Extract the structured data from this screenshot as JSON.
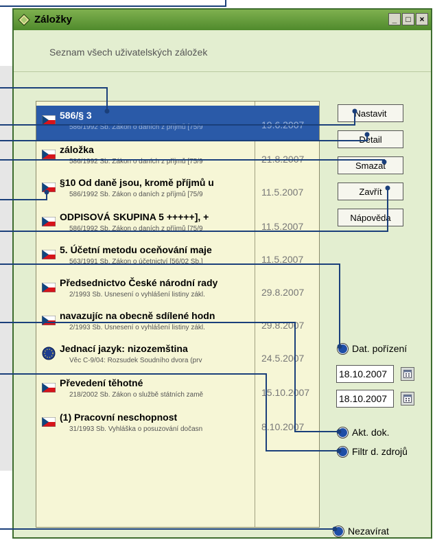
{
  "window": {
    "title": "Záložky",
    "subtitle": "Seznam všech uživatelských záložek",
    "controls": [
      "_",
      "□",
      "×"
    ],
    "accent_color": "#2a5aa8"
  },
  "bookmarks": [
    {
      "title": "586/§ 3",
      "subtitle": "586/1992 Sb. Zákon o daních z příjmů [75/9",
      "date": "19.6.2007",
      "icon": "czech-flag-icon",
      "selected": true
    },
    {
      "title": "záložka",
      "subtitle": "586/1992 Sb. Zákon o daních z příjmů [75/9",
      "date": "21.8.2007",
      "icon": "czech-flag-icon",
      "selected": false
    },
    {
      "title": "§10 Od daně jsou, kromě příjmů u",
      "subtitle": "586/1992 Sb. Zákon o daních z příjmů [75/9",
      "date": "11.5.2007",
      "icon": "czech-flag-icon",
      "selected": false
    },
    {
      "title": "ODPISOVÁ SKUPINA 5 +++++], +",
      "subtitle": "586/1992 Sb. Zákon o daních z příjmů [75/9",
      "date": "11.5.2007",
      "icon": "czech-flag-icon",
      "selected": false
    },
    {
      "title": "5. Účetní metodu oceňování maje",
      "subtitle": "563/1991 Sb. Zákon o účetnictví [56/02 Sb.]",
      "date": "11.5.2007",
      "icon": "czech-flag-icon",
      "selected": false
    },
    {
      "title": "Předsednictvo České národní rady",
      "subtitle": "2/1993 Sb. Usnesení o vyhlášení listiny zákl.",
      "date": "29.8.2007",
      "icon": "czech-flag-icon",
      "selected": false
    },
    {
      "title": "navazujíc na obecně sdílené hodn",
      "subtitle": "2/1993 Sb. Usnesení o vyhlášení listiny zákl.",
      "date": "29.8.2007",
      "icon": "czech-flag-icon",
      "selected": false
    },
    {
      "title": "Jednací jazyk: nizozemština",
      "subtitle": "Věc C-9/04: Rozsudek Soudního dvora (prv",
      "date": "24.5.2007",
      "icon": "eu-globe-icon",
      "selected": false
    },
    {
      "title": "Převedení těhotné",
      "subtitle": "218/2002 Sb. Zákon o službě státních zamě",
      "date": "15.10.2007",
      "icon": "czech-flag-icon",
      "selected": false
    },
    {
      "title": "(1) Pracovní neschopnost",
      "subtitle": "31/1993 Sb. Vyhláška o posuzování dočasn",
      "date": "8.10.2007",
      "icon": "czech-flag-icon",
      "selected": false
    }
  ],
  "buttons": {
    "set": "Nastavit",
    "detail": "Detail",
    "delete": "Smazat",
    "close": "Zavřít",
    "help": "Nápověda"
  },
  "filters": {
    "date_acquired": "Dat. pořízení",
    "date_from": "18.10.2007",
    "date_to": "18.10.2007",
    "current_doc": "Akt. dok.",
    "source_filter": "Filtr d. zdrojů",
    "keep_open": "Nezavírat"
  }
}
